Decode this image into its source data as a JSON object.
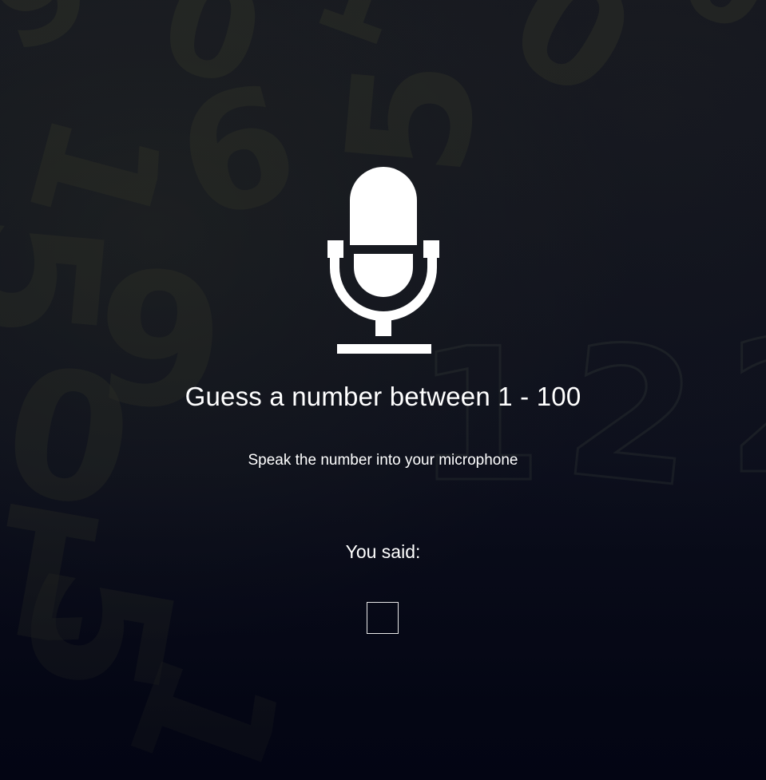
{
  "game": {
    "title": "Guess a number between 1 - 100",
    "instruction": "Speak the number into your microphone",
    "you_said_label": "You said:",
    "you_said_value": ""
  },
  "icons": {
    "microphone": "microphone-icon"
  },
  "colors": {
    "background": "#0b0f1d",
    "text": "#ffffff",
    "box_border": "#e8e8e8"
  }
}
